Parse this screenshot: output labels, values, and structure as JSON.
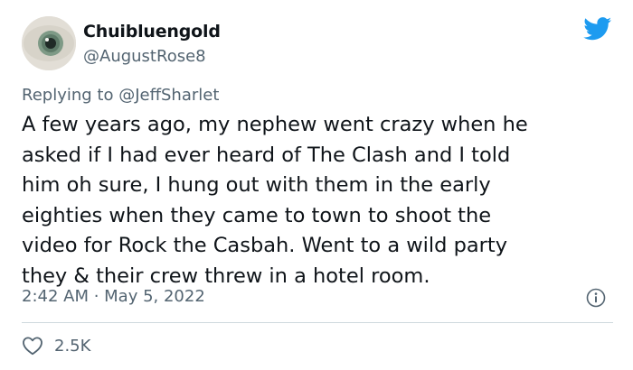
{
  "author": {
    "display_name": "Chuibluengold",
    "handle": "@AugustRose8"
  },
  "reply": {
    "prefix": "Replying to",
    "mention": "@JeffSharlet"
  },
  "tweet": {
    "lines": [
      "A few years ago, my nephew went crazy when he",
      "asked if I had ever heard of The Clash and I told",
      "him oh sure, I hung out with them in the early",
      "eighties when they came to town to shoot the",
      "video for Rock the Casbah. Went to a wild party",
      "they & their crew threw in a hotel room."
    ]
  },
  "meta": {
    "timestamp": "2:42 AM · May 5, 2022"
  },
  "actions": {
    "likes": "2.5K"
  },
  "icons": {
    "brand": "twitter-bird-icon",
    "info": "info-icon",
    "like": "heart-icon"
  },
  "colors": {
    "brand": "#1d9bf0",
    "secondary_text": "#536471",
    "primary_text": "#0f1419",
    "divider": "#cfd9de"
  }
}
